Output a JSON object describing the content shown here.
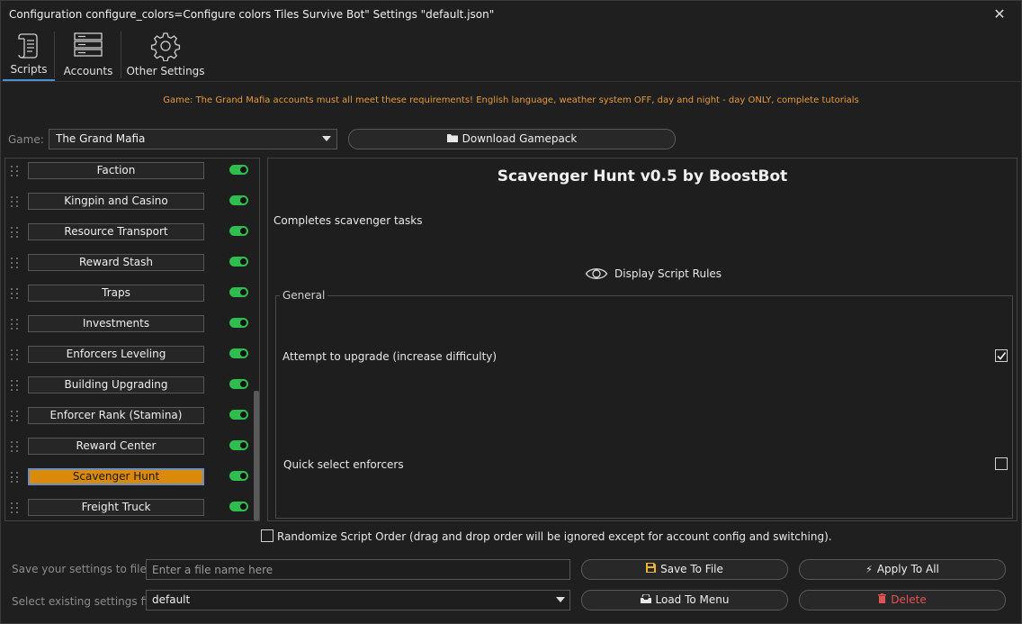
{
  "window": {
    "title": "Configuration configure_colors=Configure colors Tiles Survive Bot\" Settings \"default.json\"",
    "close_glyph": "✕"
  },
  "tabs": [
    {
      "label": "Scripts",
      "icon": "scroll-icon",
      "active": true
    },
    {
      "label": "Accounts",
      "icon": "server-icon",
      "active": false
    },
    {
      "label": "Other Settings",
      "icon": "gear-icon",
      "active": false
    }
  ],
  "notice": "Game: The Grand Mafia accounts must all meet these requirements! English language, weather system OFF, day and night - day ONLY, complete tutorials",
  "game": {
    "label": "Game:",
    "selected": "The Grand Mafia",
    "download_label": "Download Gamepack",
    "download_icon": "folder-icon"
  },
  "scripts": [
    {
      "name": "Faction",
      "enabled": true,
      "active": false
    },
    {
      "name": "Kingpin and Casino",
      "enabled": true,
      "active": false
    },
    {
      "name": "Resource Transport",
      "enabled": true,
      "active": false
    },
    {
      "name": "Reward Stash",
      "enabled": true,
      "active": false
    },
    {
      "name": "Traps",
      "enabled": true,
      "active": false
    },
    {
      "name": "Investments",
      "enabled": true,
      "active": false
    },
    {
      "name": "Enforcers Leveling",
      "enabled": true,
      "active": false
    },
    {
      "name": "Building Upgrading",
      "enabled": true,
      "active": false
    },
    {
      "name": "Enforcer Rank (Stamina)",
      "enabled": true,
      "active": false
    },
    {
      "name": "Reward Center",
      "enabled": true,
      "active": false
    },
    {
      "name": "Scavenger Hunt",
      "enabled": true,
      "active": true
    },
    {
      "name": "Freight Truck",
      "enabled": true,
      "active": false
    }
  ],
  "detail": {
    "title": "Scavenger Hunt v0.5 by BoostBot",
    "description": "Completes scavenger tasks",
    "rules_label": "Display Script Rules",
    "group_title": "General",
    "options": [
      {
        "label": "Attempt to upgrade (increase difficulty)",
        "checked": true
      },
      {
        "label": "Quick select enforcers",
        "checked": false
      }
    ]
  },
  "randomize": {
    "label": "Randomize Script Order (drag and drop order will be ignored except for account config and switching).",
    "checked": false
  },
  "settings_file": {
    "save_label": "Save your settings to file",
    "save_placeholder": "Enter a file name here",
    "select_label": "Select existing settings file",
    "selected": "default",
    "save_button": "Save To File",
    "apply_button": "Apply To All",
    "load_button": "Load To Menu",
    "delete_button": "Delete"
  },
  "colors": {
    "accent_orange": "#d98a0a",
    "toggle_green": "#2fbd4f",
    "notice_orange": "#e39a3c",
    "delete_red": "#e05454",
    "tab_underline": "#4a90d9"
  }
}
